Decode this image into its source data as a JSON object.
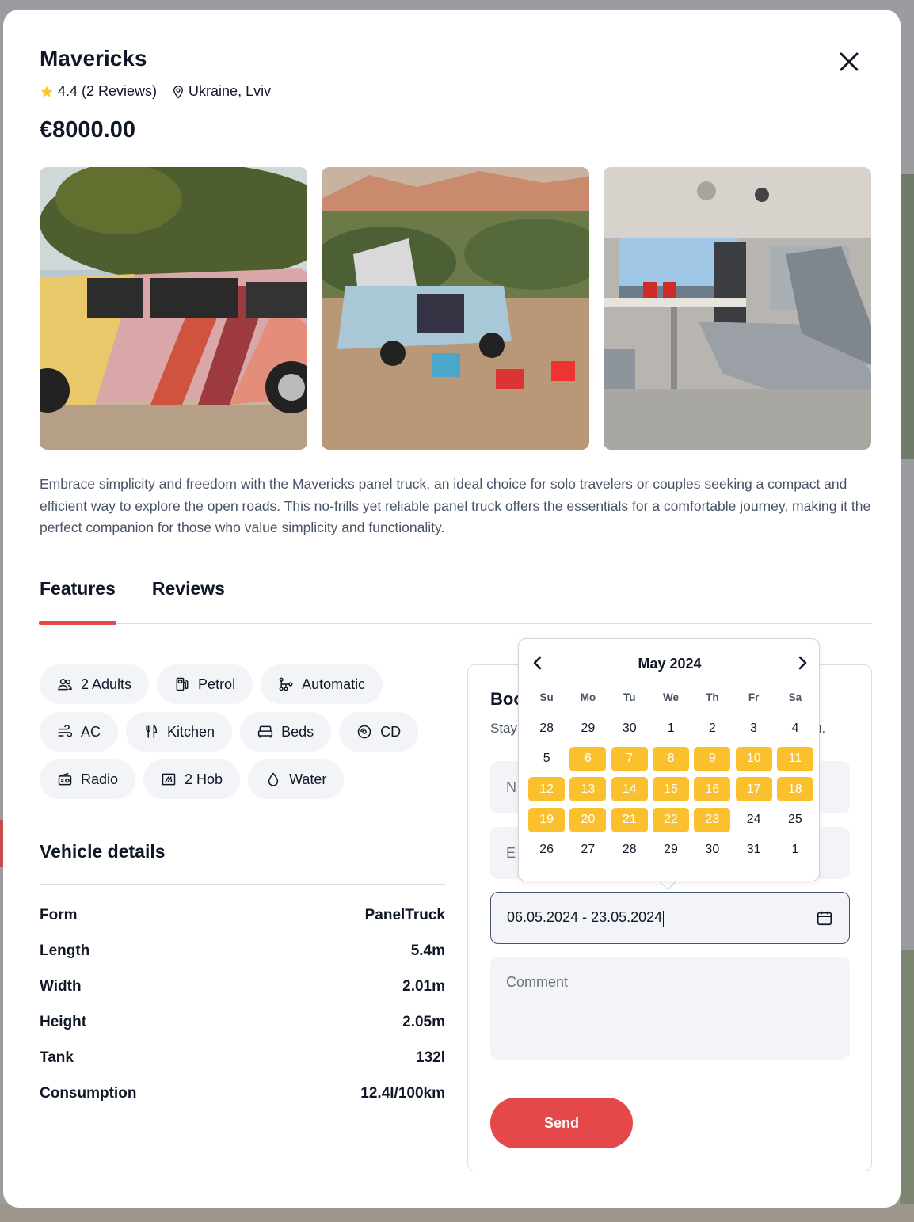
{
  "camper": {
    "name": "Mavericks",
    "rating_text": "4.4 (2 Reviews)",
    "location": "Ukraine, Lviv",
    "price": "€8000.00",
    "description": "Embrace simplicity and freedom with the Mavericks panel truck, an ideal choice for solo travelers or couples seeking a compact and efficient way to explore the open roads. This no-frills yet reliable panel truck offers the essentials for a comfortable journey, making it the perfect companion for those who value simplicity and functionality."
  },
  "tabs": [
    {
      "label": "Features",
      "active": true
    },
    {
      "label": "Reviews",
      "active": false
    }
  ],
  "features": [
    {
      "icon": "adults-icon",
      "label": "2 Adults"
    },
    {
      "icon": "fuel-icon",
      "label": "Petrol"
    },
    {
      "icon": "transmission-icon",
      "label": "Automatic"
    },
    {
      "icon": "ac-icon",
      "label": "AC"
    },
    {
      "icon": "kitchen-icon",
      "label": "Kitchen"
    },
    {
      "icon": "bed-icon",
      "label": "Beds"
    },
    {
      "icon": "cd-icon",
      "label": "CD"
    },
    {
      "icon": "radio-icon",
      "label": "Radio"
    },
    {
      "icon": "hob-icon",
      "label": "2 Hob"
    },
    {
      "icon": "water-icon",
      "label": "Water"
    }
  ],
  "vehicle_details": {
    "title": "Vehicle details",
    "rows": [
      {
        "label": "Form",
        "value": "PanelTruck"
      },
      {
        "label": "Length",
        "value": "5.4m"
      },
      {
        "label": "Width",
        "value": "2.01m"
      },
      {
        "label": "Height",
        "value": "2.05m"
      },
      {
        "label": "Tank",
        "value": "132l"
      },
      {
        "label": "Consumption",
        "value": "12.4l/100km"
      }
    ]
  },
  "booking": {
    "title": "Boo",
    "subtitle": "Stay",
    "subtitle_end": "u.",
    "name_placeholder": "N",
    "email_placeholder": "E",
    "date_value": "06.05.2024 - 23.05.2024",
    "comment_placeholder": "Comment",
    "send_label": "Send"
  },
  "calendar": {
    "month": "May 2024",
    "weekdays": [
      "Su",
      "Mo",
      "Tu",
      "We",
      "Th",
      "Fr",
      "Sa"
    ],
    "weeks": [
      [
        "28",
        "29",
        "30",
        "1",
        "2",
        "3",
        "4"
      ],
      [
        "5",
        "6",
        "7",
        "8",
        "9",
        "10",
        "11"
      ],
      [
        "12",
        "13",
        "14",
        "15",
        "16",
        "17",
        "18"
      ],
      [
        "19",
        "20",
        "21",
        "22",
        "23",
        "24",
        "25"
      ],
      [
        "26",
        "27",
        "28",
        "29",
        "30",
        "31",
        "1"
      ]
    ],
    "selected_range": [
      "6",
      "23"
    ],
    "accent": "#fbc02d"
  },
  "colors": {
    "primary": "#e44848",
    "text": "#101828",
    "muted": "#475467",
    "chip_bg": "#f2f4f7",
    "star": "#ffc531"
  }
}
